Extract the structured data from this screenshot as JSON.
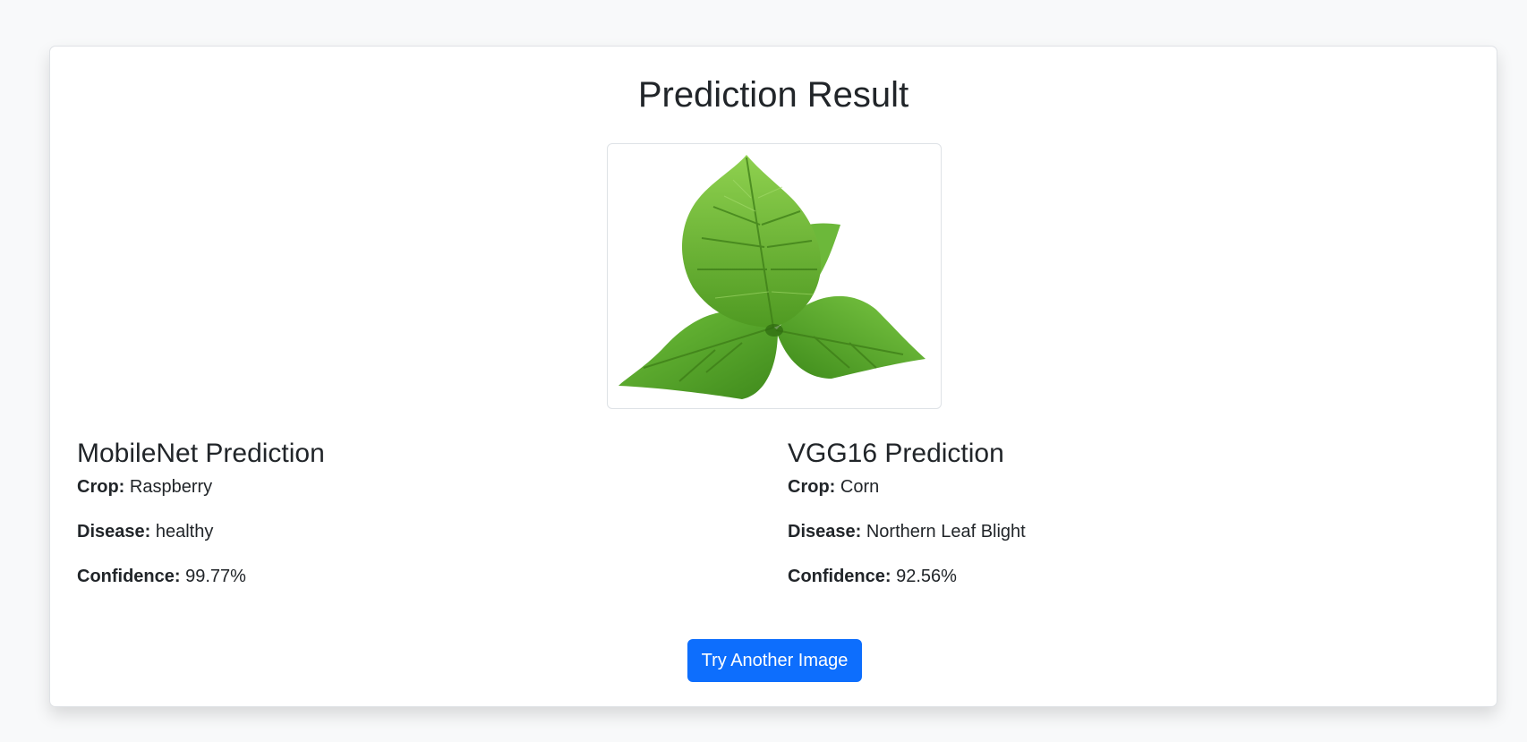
{
  "page": {
    "title": "Prediction Result",
    "image_alt": "Uploaded leaf image",
    "button_label": "Try Another Image",
    "accent_color": "#0d6efd"
  },
  "predictions": [
    {
      "heading": "MobileNet Prediction",
      "crop_label": "Crop:",
      "crop": "Raspberry",
      "disease_label": "Disease:",
      "disease": "healthy",
      "confidence_label": "Confidence:",
      "confidence": "99.77%"
    },
    {
      "heading": "VGG16 Prediction",
      "crop_label": "Crop:",
      "crop": "Corn",
      "disease_label": "Disease:",
      "disease": "Northern Leaf Blight",
      "confidence_label": "Confidence:",
      "confidence": "92.56%"
    }
  ]
}
